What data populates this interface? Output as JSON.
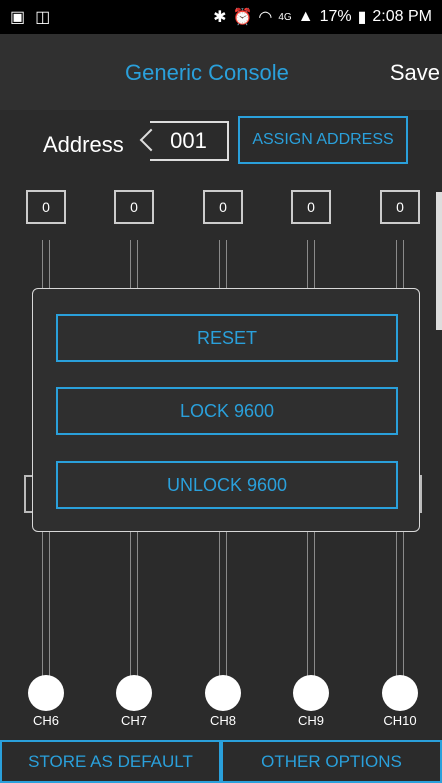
{
  "status_bar": {
    "battery": "17%",
    "time": "2:08 PM",
    "network": "4G"
  },
  "app_bar": {
    "title": "Generic Console",
    "save_label": "Save"
  },
  "address": {
    "label": "Address",
    "value": "001",
    "assign_label": "ASSIGN ADDRESS"
  },
  "channels": [
    {
      "label": "CH6",
      "value": "0"
    },
    {
      "label": "CH7",
      "value": "0"
    },
    {
      "label": "CH8",
      "value": "0"
    },
    {
      "label": "CH9",
      "value": "0"
    },
    {
      "label": "CH10",
      "value": "0"
    }
  ],
  "dialog": {
    "buttons": [
      "RESET",
      "LOCK 9600",
      "UNLOCK 9600"
    ]
  },
  "bottom_bar": {
    "store_default_label": "STORE AS DEFAULT",
    "other_options_label": "OTHER OPTIONS"
  },
  "colors": {
    "accent": "#2aa0db",
    "background": "#2b2b2b"
  }
}
